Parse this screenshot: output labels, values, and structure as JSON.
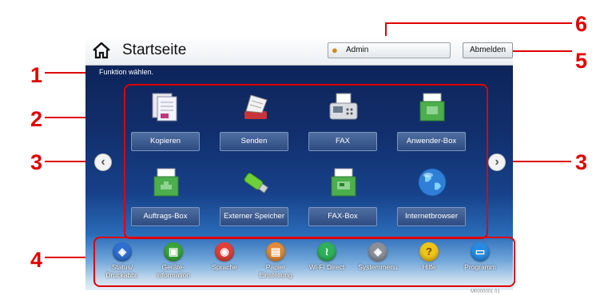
{
  "callouts": [
    "1",
    "2",
    "3",
    "3",
    "4",
    "5",
    "6"
  ],
  "header": {
    "title": "Startseite",
    "admin_label": "Admin",
    "logout_label": "Abmelden"
  },
  "prompt": "Funktion wählen.",
  "tiles": [
    {
      "label": "Kopieren",
      "icon": "copy-icon"
    },
    {
      "label": "Senden",
      "icon": "send-icon"
    },
    {
      "label": "FAX",
      "icon": "fax-icon"
    },
    {
      "label": "Anwender-Box",
      "icon": "user-box-icon"
    },
    {
      "label": "Auftrags-Box",
      "icon": "job-box-icon"
    },
    {
      "label": "Externer Speicher",
      "icon": "usb-drive-icon"
    },
    {
      "label": "FAX-Box",
      "icon": "fax-box-icon"
    },
    {
      "label": "Internetbrowser",
      "icon": "globe-icon"
    }
  ],
  "taskbar": [
    {
      "label": "Status/ Druckabbr.",
      "icon": "status-icon",
      "color": "#2f6fd0"
    },
    {
      "label": "Geräte- information",
      "icon": "device-info-icon",
      "color": "#3aa33a"
    },
    {
      "label": "Sprache",
      "icon": "language-icon",
      "color": "#e0403a"
    },
    {
      "label": "Papier Einstellung",
      "icon": "paper-icon",
      "color": "#e08a3a"
    },
    {
      "label": "Wi-Fi Direct",
      "icon": "wifi-direct-icon",
      "color": "#2fb05a"
    },
    {
      "label": "Systemmenu",
      "icon": "system-menu-icon",
      "color": "#8a8f99"
    },
    {
      "label": "Hilfe",
      "icon": "help-icon",
      "color": "#f0c419"
    },
    {
      "label": "Programm",
      "icon": "program-icon",
      "color": "#2a8ae0"
    }
  ],
  "footnote": "M0000001 01"
}
